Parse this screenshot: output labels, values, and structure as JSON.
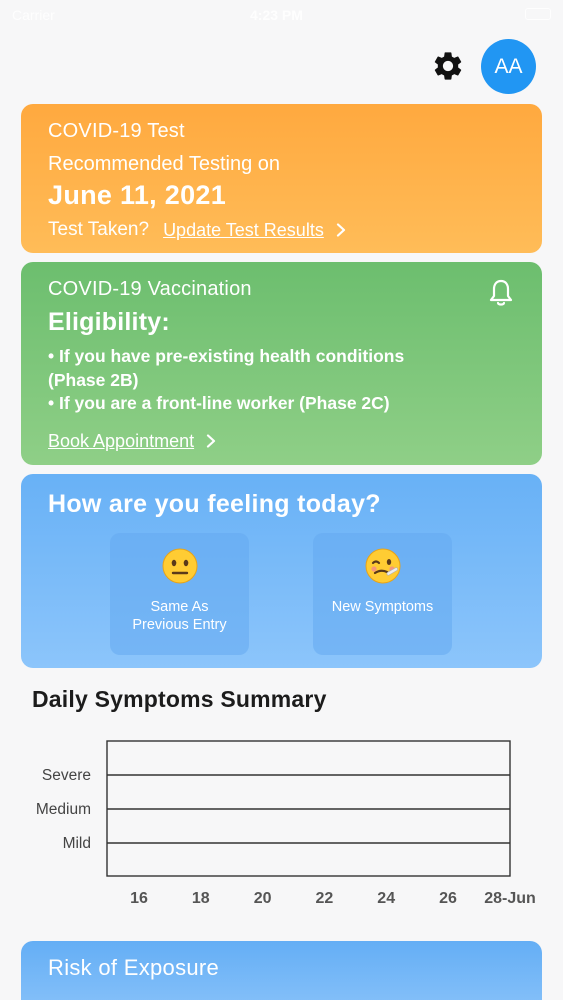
{
  "status_bar": {
    "carrier": "Carrier",
    "time": "4:23 PM"
  },
  "header": {
    "avatar_initials": "AA",
    "settings_icon": "gear-icon"
  },
  "test_card": {
    "title": "COVID-19 Test",
    "subtitle": "Recommended Testing on",
    "date": "June 11, 2021",
    "prompt": "Test Taken?",
    "link": "Update Test Results"
  },
  "vaccination_card": {
    "title": "COVID-19 Vaccination",
    "heading": "Eligibility:",
    "bullets": [
      "• If you have pre-existing health conditions",
      "(Phase 2B)",
      "• If you are a front-line worker (Phase 2C)"
    ],
    "link": "Book Appointment",
    "bell_icon": "bell-icon"
  },
  "feeling_card": {
    "title": "How are you feeling today?",
    "options": [
      {
        "label_line1": "Same As",
        "label_line2": "Previous Entry",
        "emoji": "neutral-face"
      },
      {
        "label_line1": "New Symptoms",
        "label_line2": "",
        "emoji": "woozy-face"
      }
    ]
  },
  "summary": {
    "title": "Daily Symptoms Summary"
  },
  "chart_data": {
    "type": "line",
    "y_categories": [
      "Mild",
      "Medium",
      "Severe"
    ],
    "x_ticks": [
      "16",
      "18",
      "20",
      "22",
      "24",
      "26",
      "28-Jun"
    ],
    "series": []
  },
  "risk_card": {
    "title": "Risk of Exposure"
  },
  "colors": {
    "test": "#ffa93f",
    "vaccination": "#6cbe6e",
    "feeling": "#68b1f6",
    "avatar": "#2196f3"
  }
}
